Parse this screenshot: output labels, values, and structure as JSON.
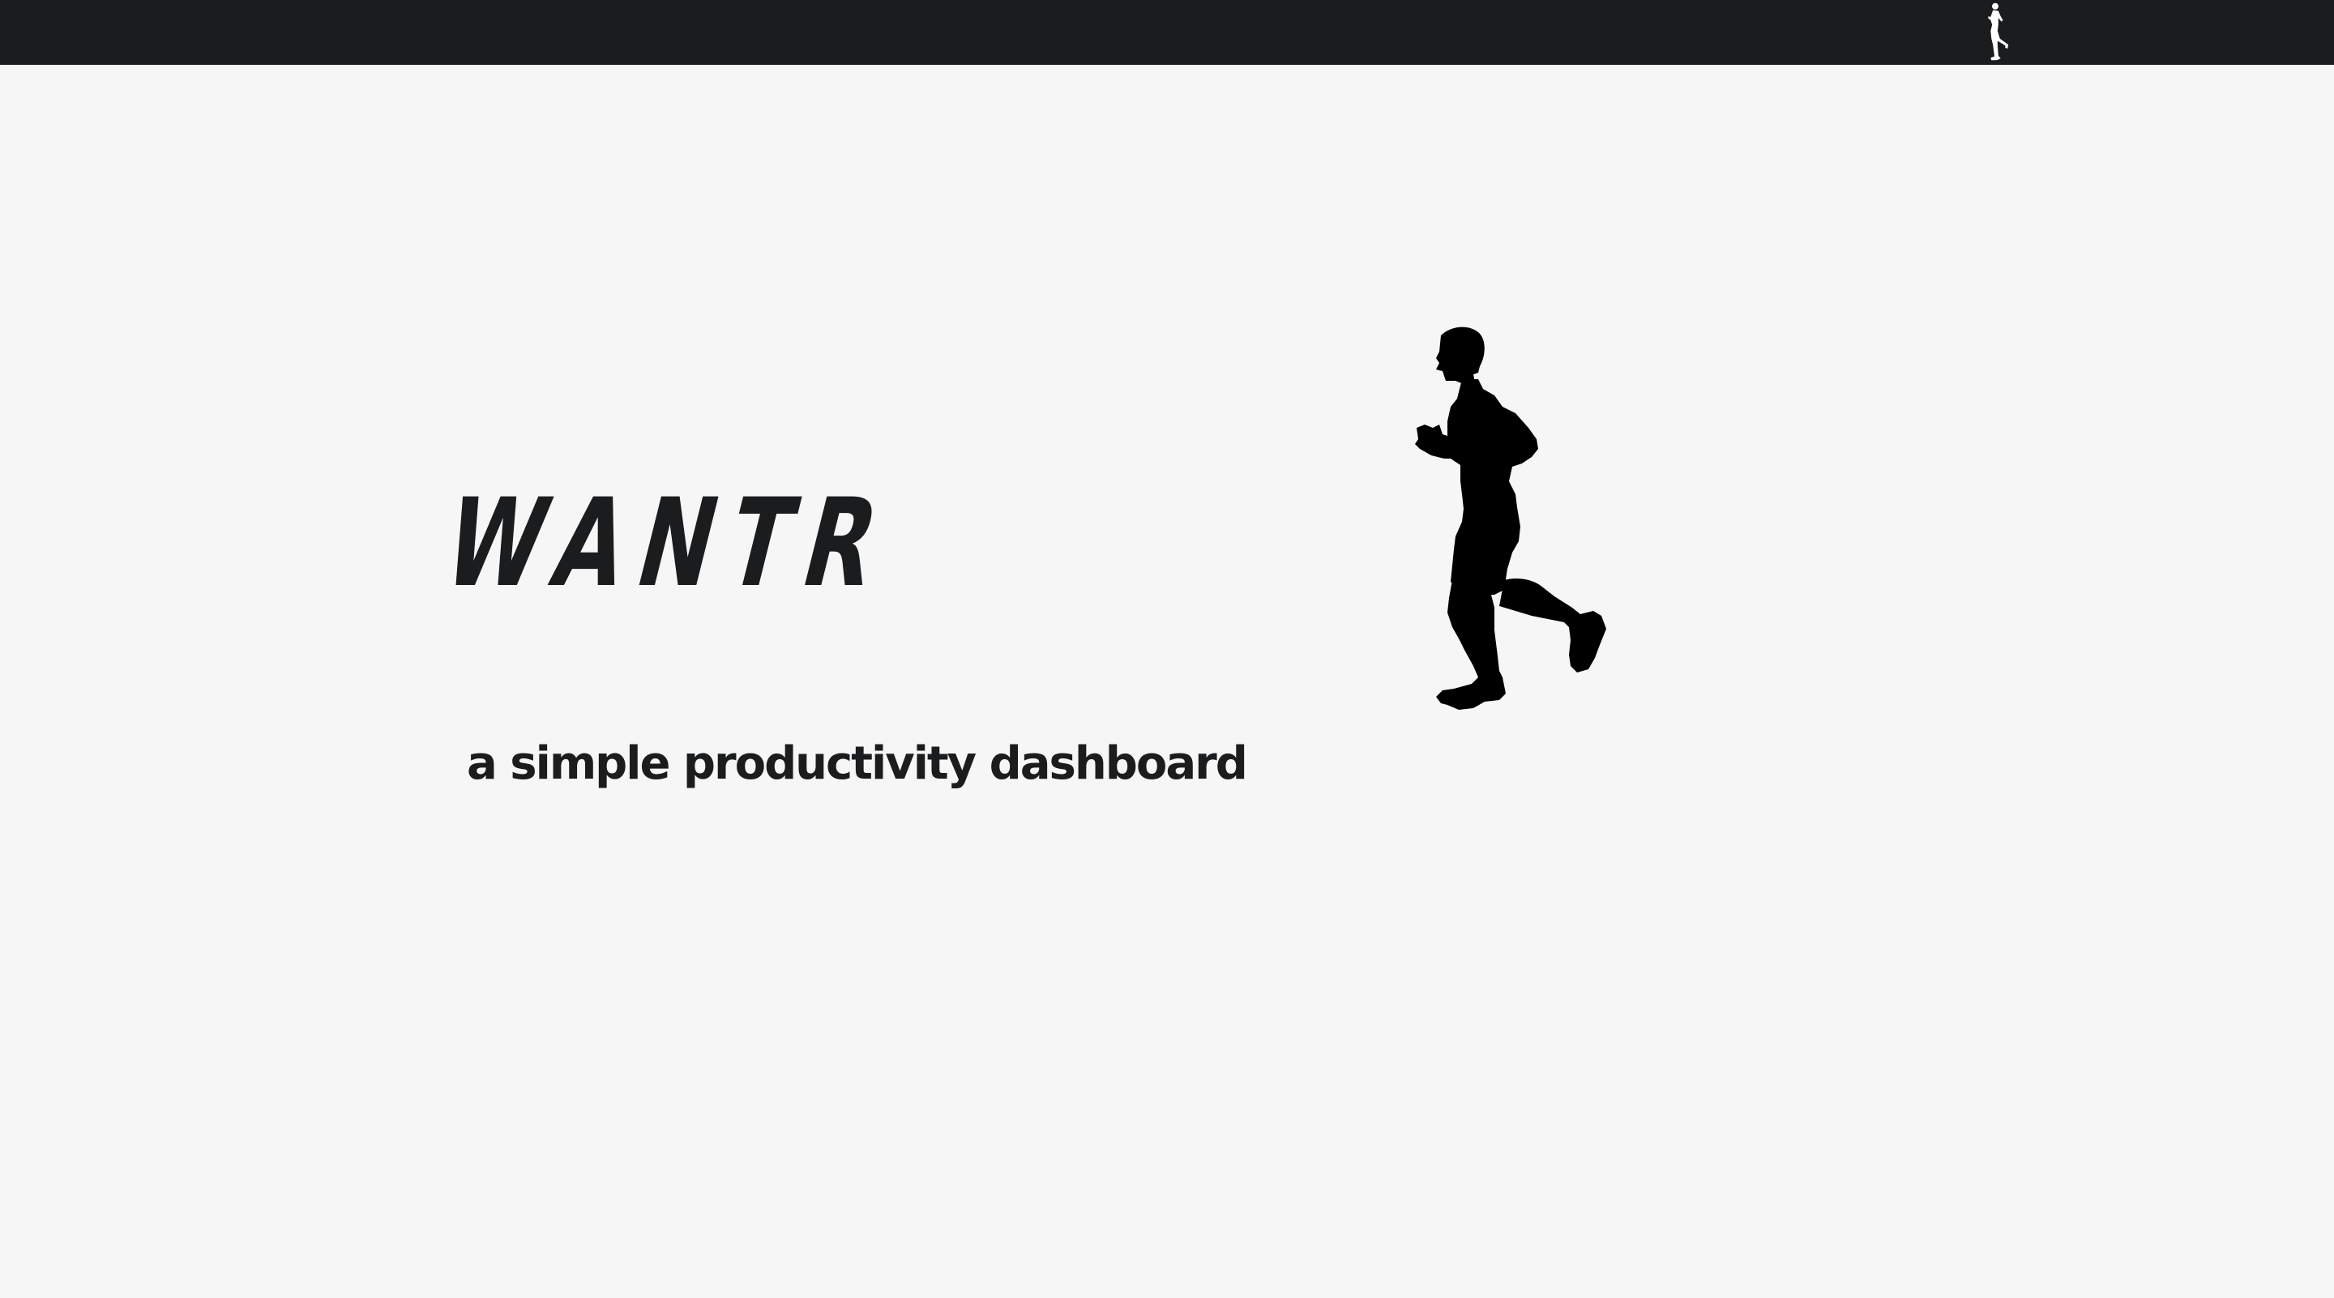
{
  "header": {
    "logo_icon": "runner-icon",
    "background_color": "#1b1c1e"
  },
  "hero": {
    "brand": "WANTR",
    "tagline": "a simple productivity dashboard",
    "illustration_icon": "runner-silhouette-icon",
    "text_color": "#1b1c1e",
    "background_color": "#f6f6f6"
  }
}
